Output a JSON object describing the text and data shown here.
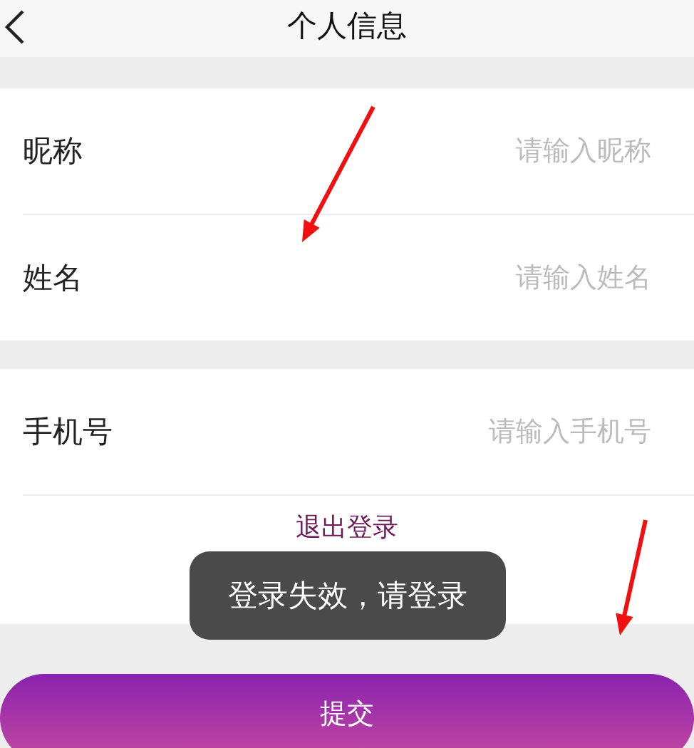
{
  "header": {
    "title": "个人信息"
  },
  "groups": [
    {
      "rows": [
        {
          "kind": "field",
          "label": "昵称",
          "placeholder": "请输入昵称"
        },
        {
          "kind": "field",
          "label": "姓名",
          "placeholder": "请输入姓名"
        }
      ]
    },
    {
      "rows": [
        {
          "kind": "field",
          "label": "手机号",
          "placeholder": "请输入手机号"
        },
        {
          "kind": "action",
          "label": "退出登录"
        }
      ]
    }
  ],
  "toast": "登录失效，请登录",
  "submit": "提交"
}
